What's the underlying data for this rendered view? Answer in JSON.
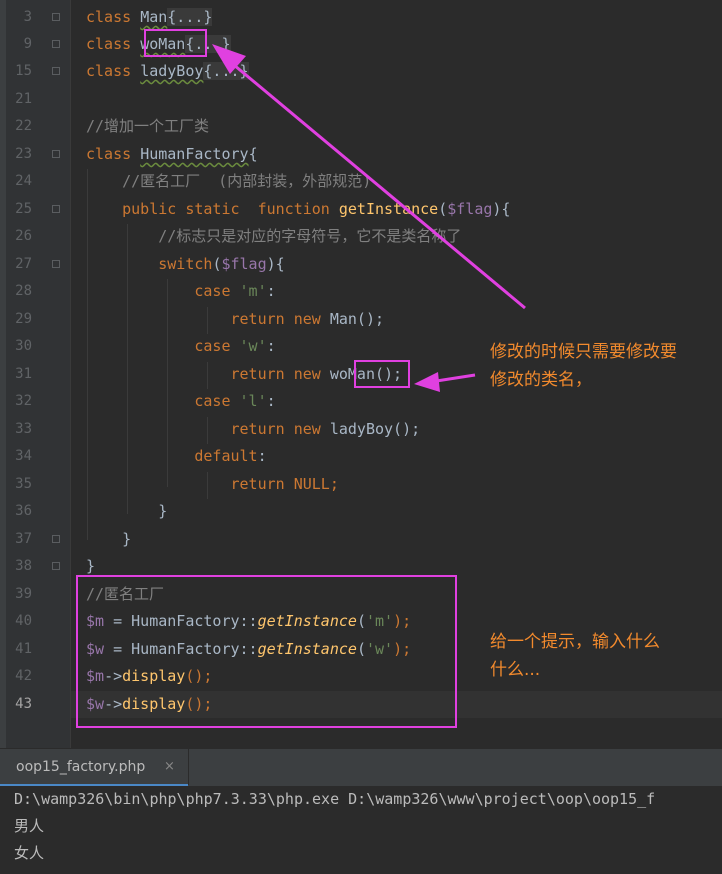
{
  "editor": {
    "line_numbers": [
      "3",
      "9",
      "15",
      "21",
      "22",
      "23",
      "24",
      "25",
      "26",
      "27",
      "28",
      "29",
      "30",
      "31",
      "32",
      "33",
      "34",
      "35",
      "36",
      "37",
      "38",
      "39",
      "40",
      "41",
      "42",
      "43"
    ],
    "current_line": "43",
    "lines": {
      "l3": [
        "class",
        " ",
        "Man",
        "{...}"
      ],
      "l9": [
        "class",
        " ",
        "woMan",
        "{...}"
      ],
      "l15": [
        "class",
        " ",
        "ladyBoy",
        "{...}"
      ],
      "l22": [
        "//增加一个工厂类"
      ],
      "l23": [
        "class",
        " ",
        "HumanFactory",
        "{"
      ],
      "l24": [
        "    ",
        "//匿名工厂  (内部封装，外部规范)"
      ],
      "l25": [
        "    ",
        "public",
        " ",
        "static",
        "  ",
        "function",
        " ",
        "getInstance",
        "(",
        "$flag",
        "){"
      ],
      "l26": [
        "        ",
        "//标志只是对应的字母符号，它不是类名称了"
      ],
      "l27": [
        "        ",
        "switch",
        "(",
        "$flag",
        "){"
      ],
      "l28": [
        "            ",
        "case",
        " ",
        "'m'",
        ":"
      ],
      "l29": [
        "                ",
        "return",
        " ",
        "new",
        " ",
        "Man();"
      ],
      "l30": [
        "            ",
        "case",
        " ",
        "'w'",
        ":"
      ],
      "l31": [
        "                ",
        "return",
        " ",
        "new",
        " ",
        "woMan",
        "();"
      ],
      "l32": [
        "            ",
        "case",
        " ",
        "'l'",
        ":"
      ],
      "l33": [
        "                ",
        "return",
        " ",
        "new",
        " ",
        "ladyBoy();"
      ],
      "l34": [
        "            ",
        "default",
        ":"
      ],
      "l35": [
        "                ",
        "return",
        " ",
        "NULL",
        ";"
      ],
      "l36": [
        "        ",
        "}"
      ],
      "l37": [
        "    ",
        "}"
      ],
      "l38": [
        "}"
      ],
      "l39": [
        "//匿名工厂"
      ],
      "l40": [
        "$m",
        " = HumanFactory::",
        "getInstance",
        "(",
        "'m'",
        ");"
      ],
      "l41": [
        "$w",
        " = HumanFactory::",
        "getInstance",
        "(",
        "'w'",
        ");"
      ],
      "l42": [
        "$m",
        "->",
        "display",
        "();"
      ],
      "l43": [
        "$w",
        "->",
        "display",
        "();"
      ]
    }
  },
  "annotations": {
    "note1": [
      "修改的时候只需要修改要",
      "修改的类名，"
    ],
    "note2": [
      "给一个提示，输入什么",
      "什么..."
    ],
    "color": "#f28a2d",
    "box_color": "#e040e0"
  },
  "run_panel": {
    "tab_label": "oop15_factory.php",
    "tab_close": "×",
    "output": [
      "D:\\wamp326\\bin\\php\\php7.3.33\\php.exe D:\\wamp326\\www\\project\\oop\\oop15_f",
      "男人",
      "女人"
    ]
  }
}
